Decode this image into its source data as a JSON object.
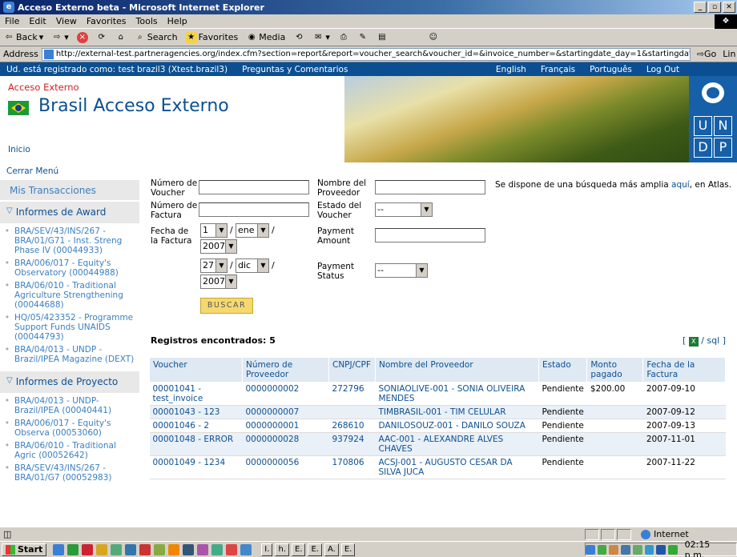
{
  "window": {
    "title": "Acceso Externo beta - Microsoft Internet Explorer"
  },
  "menubar": [
    "File",
    "Edit",
    "View",
    "Favorites",
    "Tools",
    "Help"
  ],
  "toolbar": {
    "back": "Back",
    "search": "Search",
    "favorites": "Favorites",
    "media": "Media"
  },
  "addressbar": {
    "label": "Address",
    "url": "http://external-test.partneragencies.org/index.cfm?section=report&report=voucher_search&voucher_id=&invoice_number=&startingdate_day=1&startingdate_month=1&star",
    "go": "Go",
    "links": "Lin"
  },
  "topnav": {
    "registered": "Ud. está registrado como: test brazil3 (Xtest.brazil3)",
    "faq": "Preguntas y Comentarios",
    "english": "English",
    "french": "Français",
    "portuguese": "Português",
    "logout": "Log Out"
  },
  "header": {
    "small_title": "Acceso Externo",
    "big_title": "Brasil Acceso Externo",
    "inicio": "Inicio",
    "undp_letters": [
      "U",
      "N",
      "D",
      "P"
    ]
  },
  "sidebar": {
    "cerrar": "Cerrar Menú",
    "mis_transacciones": "Mis Transacciones",
    "informes_award": "Informes de Award",
    "award_items": [
      "BRA/SEV/43/INS/267 - BRA/01/G71 - Inst. Streng Phase IV (00044933)",
      "BRA/006/017 - Equity's Observatory (00044988)",
      "BRA/06/010 - Traditional Agriculture Strengthening (00044688)",
      "HQ/05/423352 - Programme Support Funds UNAIDS (00044793)",
      "BRA/04/013 - UNDP - Brazil/IPEA Magazine (DEXT)"
    ],
    "informes_proyecto": "Informes de Proyecto",
    "project_items": [
      "BRA/04/013 - UNDP-Brazil/IPEA (00040441)",
      "BRA/006/017 - Equity's Observa (00053060)",
      "BRA/06/010 - Traditional Agric (00052642)",
      "BRA/SEV/43/INS/267 - BRA/01/G7 (00052983)"
    ]
  },
  "form": {
    "numero_voucher": "Número de Voucher",
    "nombre_proveedor": "Nombre del Proveedor",
    "numero_factura": "Número de Factura",
    "estado_voucher": "Estado del Voucher",
    "estado_value": "--",
    "fecha_factura": "Fecha de la Factura",
    "start_day": "1",
    "start_month": "ene",
    "start_year": "2007",
    "end_day": "27",
    "end_month": "dic",
    "end_year": "2007",
    "payment_amount": "Payment Amount",
    "payment_status": "Payment Status",
    "payment_status_value": "--",
    "buscar": "BUSCAR",
    "note_pre": "Se dispone de una búsqueda más amplia ",
    "note_link": "aquí",
    "note_post": ", en Atlas."
  },
  "results": {
    "title": "Registros encontrados: 5",
    "export_open": "[",
    "export_sql": "/ sql ]",
    "columns": [
      "Voucher",
      "Número de Proveedor",
      "CNPJ/CPF",
      "Nombre del Proveedor",
      "Estado",
      "Monto pagado",
      "Fecha de la Factura"
    ],
    "rows": [
      [
        "00001041 - test_invoice",
        "0000000002",
        "272796",
        "SONIAOLIVE-001 - SONIA OLIVEIRA MENDES",
        "Pendiente",
        "$200.00",
        "2007-09-10"
      ],
      [
        "00001043 - 123",
        "0000000007",
        "",
        "TIMBRASIL-001 - TIM CELULAR",
        "Pendiente",
        "",
        "2007-09-12"
      ],
      [
        "00001046 - 2",
        "0000000001",
        "268610",
        "DANILOSOUZ-001 - DANILO SOUZA",
        "Pendiente",
        "",
        "2007-09-13"
      ],
      [
        "00001048 - ERROR",
        "0000000028",
        "937924",
        "AAC-001 - ALEXANDRE ALVES CHAVES",
        "Pendiente",
        "",
        "2007-11-01"
      ],
      [
        "00001049 - 1234",
        "0000000056",
        "170806",
        "ACSJ-001 - AUGUSTO CESAR DA SILVA JUCA",
        "Pendiente",
        "",
        "2007-11-22"
      ]
    ]
  },
  "statusbar": {
    "zone": "Internet"
  },
  "taskbar": {
    "start": "Start",
    "tasks": [
      "I.",
      "h.",
      "E.",
      "E.",
      "A.",
      "E."
    ],
    "clock": "02:15 p.m."
  }
}
